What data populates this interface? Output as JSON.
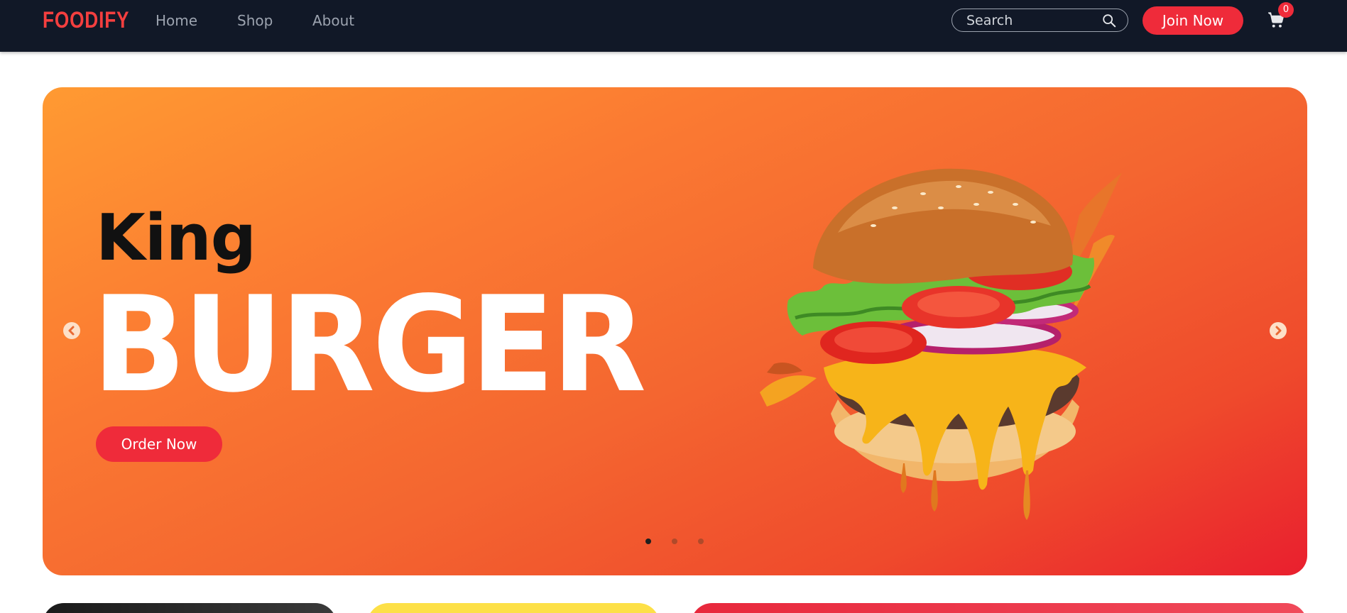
{
  "navbar": {
    "logo": "FOODIFY",
    "links": [
      "Home",
      "Shop",
      "About"
    ],
    "search_placeholder": "Search",
    "join_label": "Join Now",
    "cart_count": "0"
  },
  "hero": {
    "subtitle": "King",
    "title": "BURGER",
    "order_label": "Order Now",
    "slide_count": 3,
    "active_slide": 1
  },
  "colors": {
    "navbar_bg": "#111827",
    "brand": "#f43f3f",
    "accent_button": "#ef2b3a",
    "hero_gradient_start": "#ff9a32",
    "hero_gradient_end": "#e91f2e"
  },
  "icons": [
    "search-icon",
    "cart-icon",
    "chevron-left-icon",
    "chevron-right-icon"
  ]
}
